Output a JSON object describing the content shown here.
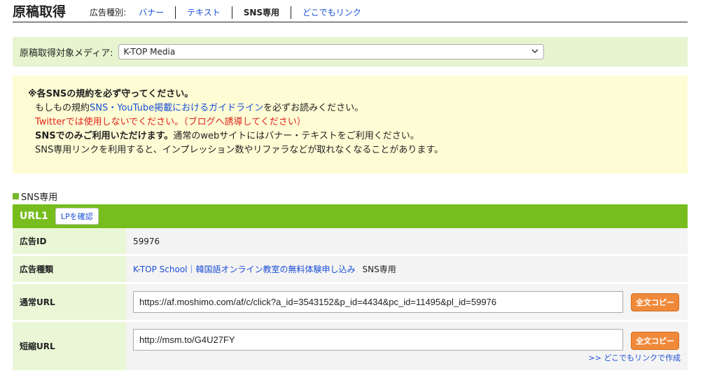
{
  "header": {
    "title": "原稿取得",
    "type_label": "広告種別:",
    "tabs": [
      {
        "label": "バナー",
        "active": false
      },
      {
        "label": "テキスト",
        "active": false
      },
      {
        "label": "SNS専用",
        "active": true
      },
      {
        "label": "どこでもリンク",
        "active": false
      }
    ]
  },
  "media": {
    "label": "原稿取得対象メディア:",
    "selected": "K-TOP Media"
  },
  "notice": {
    "title": "※各SNSの規約を必ず守ってください。",
    "line1_prefix": "もしもの規約",
    "line1_link": "SNS・YouTube掲載におけるガイドライン",
    "line1_suffix": "を必ずお読みください。",
    "line2": "Twitterでは使用しないでください。（ブログへ誘導してください）",
    "line3_bold": "SNSでのみご利用いただけます。",
    "line3_rest": "通常のwebサイトにはバナー・テキストをご利用ください。",
    "line4": "SNS専用リンクを利用すると、インプレッション数やリファラなどが取れなくなることがあります。"
  },
  "section": {
    "title": "SNS専用"
  },
  "url_block": {
    "title": "URL1",
    "lp_button": "LPを確認",
    "rows": {
      "ad_id_label": "広告ID",
      "ad_id_value": "59976",
      "ad_type_label": "広告種類",
      "ad_type_link": "K-TOP School｜韓国語オンライン教室の無料体験申し込み",
      "ad_type_suffix": "SNS専用",
      "normal_url_label": "通常URL",
      "normal_url_value": "https://af.moshimo.com/af/c/click?a_id=3543152&p_id=4434&pc_id=11495&pl_id=59976",
      "short_url_label": "短縮URL",
      "short_url_value": "http://msm.to/G4U27FY",
      "copy_button": "全文コピー",
      "make_link": ">> どこでもリンクで作成"
    }
  },
  "colors": {
    "accent_green": "#76bd1d",
    "link_blue": "#1a4fd6",
    "warning_red": "#e0211a",
    "copy_orange": "#f0893a"
  }
}
